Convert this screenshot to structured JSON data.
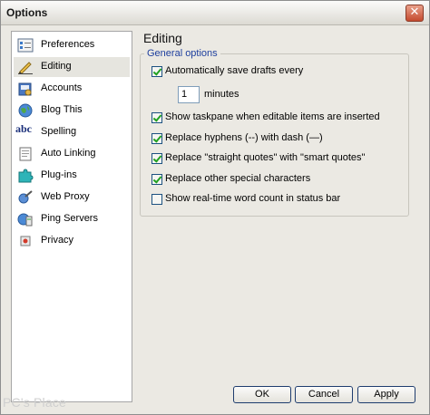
{
  "window": {
    "title": "Options",
    "close_glyph": "✕"
  },
  "sidebar": {
    "items": [
      {
        "label": "Preferences",
        "icon": "preferences-icon",
        "selected": false
      },
      {
        "label": "Editing",
        "icon": "pencil-icon",
        "selected": true
      },
      {
        "label": "Accounts",
        "icon": "book-icon",
        "selected": false
      },
      {
        "label": "Blog This",
        "icon": "globe-icon",
        "selected": false
      },
      {
        "label": "Spelling",
        "icon": "abc-icon",
        "selected": false
      },
      {
        "label": "Auto Linking",
        "icon": "document-icon",
        "selected": false
      },
      {
        "label": "Plug-ins",
        "icon": "puzzle-icon",
        "selected": false
      },
      {
        "label": "Web Proxy",
        "icon": "proxy-icon",
        "selected": false
      },
      {
        "label": "Ping Servers",
        "icon": "server-icon",
        "selected": false
      },
      {
        "label": "Privacy",
        "icon": "privacy-icon",
        "selected": false
      }
    ],
    "icon_abc_text": "abc"
  },
  "watermark": "PC's Place",
  "panel": {
    "title": "Editing",
    "group_label": "General options",
    "options": [
      {
        "label": "Automatically save drafts every",
        "checked": true
      },
      {
        "label": "Show taskpane when editable items are inserted",
        "checked": true
      },
      {
        "label": "Replace hyphens (--) with dash (—)",
        "checked": true
      },
      {
        "label": "Replace \"straight quotes\" with \"smart quotes\"",
        "checked": true
      },
      {
        "label": "Replace other special characters",
        "checked": true
      },
      {
        "label": "Show real-time word count in status bar",
        "checked": false
      }
    ],
    "autosave_minutes_value": "1",
    "autosave_minutes_unit": "minutes"
  },
  "buttons": {
    "ok": "OK",
    "cancel": "Cancel",
    "apply": "Apply"
  },
  "colors": {
    "group_label": "#1e3f9e",
    "check": "#21a121",
    "selected_row": "#e6e5df"
  }
}
